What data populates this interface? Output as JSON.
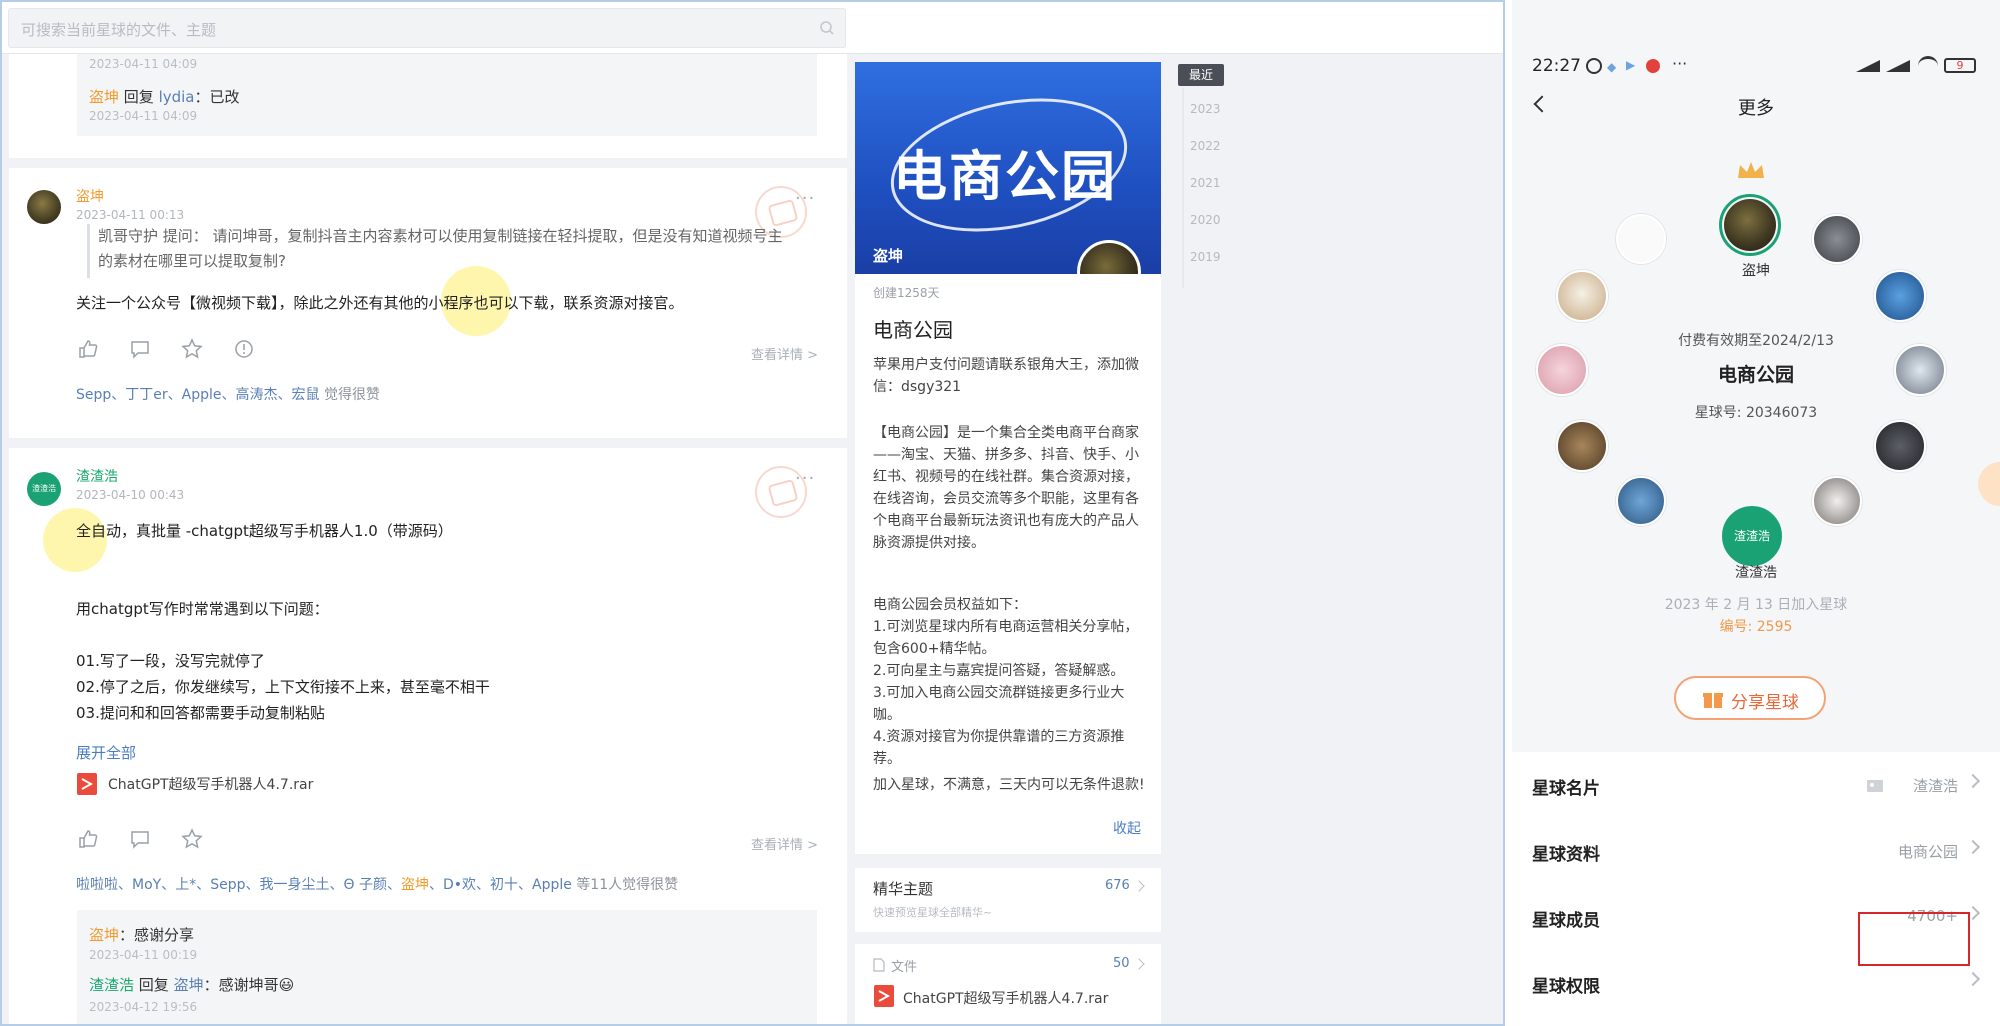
{
  "search": {
    "placeholder": "可搜索当前星球的文件、主题"
  },
  "feed": {
    "top_comments": {
      "time1": "2023-04-11 04:09",
      "reply": {
        "from": "盗坤",
        "verb": " 回复 ",
        "to": "lydia",
        "text": "：已改"
      },
      "time2": "2023-04-11 04:09"
    },
    "post1": {
      "author": "盗坤",
      "time": "2023-04-11 00:13",
      "more": "···",
      "quote_line1": "凯哥守护  提问：  请问坤哥，复制抖音主内容素材可以使用复制链接在轻抖提取，但是没有知道视频号主",
      "quote_line2": "的素材在哪里可以提取复制?",
      "text": "关注一个公众号【微视频下载】，除此之外还有其他的小程序也可以下载，联系资源对接官。",
      "detail": "查看详情 >",
      "likes": [
        "Sepp",
        "丁丁er",
        "Apple",
        "高涛杰",
        "宏鼠"
      ],
      "likes_tail": " 觉得很赞"
    },
    "post2": {
      "author": "渣渣浩",
      "avatar_text": "渣渣浩",
      "time": "2023-04-10 00:43",
      "more": "···",
      "lines": [
        "全自动，真批量 -chatgpt超级写手机器人1.0（带源码）",
        "",
        "",
        "用chatgpt写作时常常遇到以下问题：",
        "",
        "01.写了一段，没写完就停了",
        "02.停了之后，你发继续写，上下文衔接不上来，甚至毫不相干",
        "03.提问和和回答都需要手动复制粘贴"
      ],
      "expand": "展开全部",
      "attachment": "ChatGPT超级写手机器人4.7.rar",
      "detail": "查看详情 >",
      "likes": "啦啦啦、MoY、上*、Sepp、我一身尘土、Θ 子颜、",
      "likes_orange": "盗坤",
      "likes_rest": "、D•欢、初十、Apple",
      "likes_tail": " 等11人觉得很赞",
      "comments": {
        "c1_from": "盗坤",
        "c1_text": "：感谢分享",
        "c1_time": "2023-04-11 00:19",
        "c2_from": "渣渣浩",
        "c2_verb": " 回复 ",
        "c2_to": "盗坤",
        "c2_text": "：感谢坤哥😃",
        "c2_time": "2023-04-12 19:56"
      }
    }
  },
  "side": {
    "banner_title": "电商公园",
    "owner": "盗坤",
    "created": "创建1258天",
    "title": "电商公园",
    "desc1": "苹果用户支付问题请联系银角大王，添加微信：dsgy321",
    "desc2": "【电商公园】是一个集合全类电商平台商家——淘宝、天猫、拼多多、抖音、快手、小红书、视频号的在线社群。集合资源对接，在线咨询，会员交流等多个职能，这里有各个电商平台最新玩法资讯也有庞大的产品人脉资源提供对接。",
    "desc3": "电商公园会员权益如下：\n1.可浏览星球内所有电商运营相关分享帖，包含600+精华帖。\n2.可向星主与嘉宾提问答疑，答疑解惑。\n3.可加入电商公园交流群链接更多行业大咖。\n4.资源对接官为你提供靠谱的三方资源推荐。",
    "desc4": "加入星球，不满意，三天内可以无条件退款!",
    "collapse": "收起",
    "digest_title": "精华主题",
    "digest_sub": "快速预览星球全部精华~",
    "digest_count": "676",
    "files_label": "文件",
    "files_count": "50",
    "file_name": "ChatGPT超级写手机器人4.7.rar"
  },
  "years": [
    "最近",
    "2023",
    "2022",
    "2021",
    "2020",
    "2019"
  ],
  "phone": {
    "time": "22:27",
    "battery": "9",
    "title": "更多",
    "owner_name": "盗坤",
    "valid": "付费有效期至2024/2/13",
    "planet": "电商公园",
    "planet_no": "星球号: 20346073",
    "me_badge": "渣渣浩",
    "me_name": "渣渣浩",
    "joined": "2023 年 2 月 13 日加入星球",
    "member_no": "编号: 2595",
    "share": "分享星球",
    "rows": [
      {
        "key": "星球名片",
        "value": "渣渣浩"
      },
      {
        "key": "星球资料",
        "value": "电商公园"
      },
      {
        "key": "星球成员",
        "value": "4700+"
      },
      {
        "key": "星球权限",
        "value": ""
      }
    ]
  },
  "colors": {
    "accent_green": "#1ba274",
    "owner_orange": "#f29b2e",
    "link_blue": "#5a7fb5",
    "highlight_red": "#d6262e"
  }
}
